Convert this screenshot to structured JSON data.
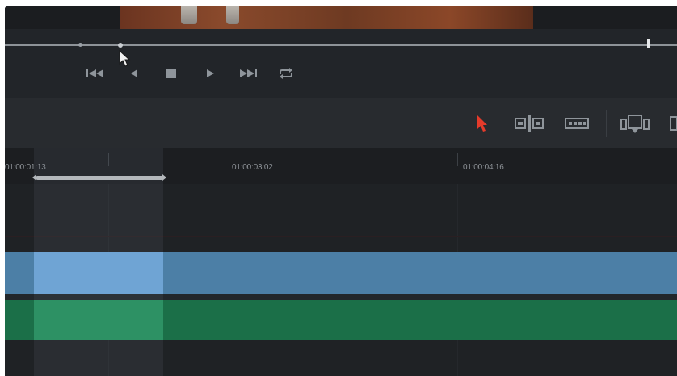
{
  "timeline": {
    "timecodes": [
      "01:00:01:13",
      "01:00:03:02",
      "01:00:04:16"
    ]
  },
  "transport": {
    "buttons": [
      "go-to-start",
      "reverse",
      "stop",
      "play",
      "go-to-end",
      "loop"
    ]
  },
  "toolbar": {
    "tools": [
      "selection",
      "trim-edit",
      "blade",
      "insert-clip"
    ]
  },
  "colors": {
    "video_track": "#4c7fa6",
    "video_clip_selected": "#6ea9dd",
    "audio_track": "#1b6f48",
    "audio_clip_selected": "#23935e",
    "selection_tool_accent": "#e53b2b"
  }
}
